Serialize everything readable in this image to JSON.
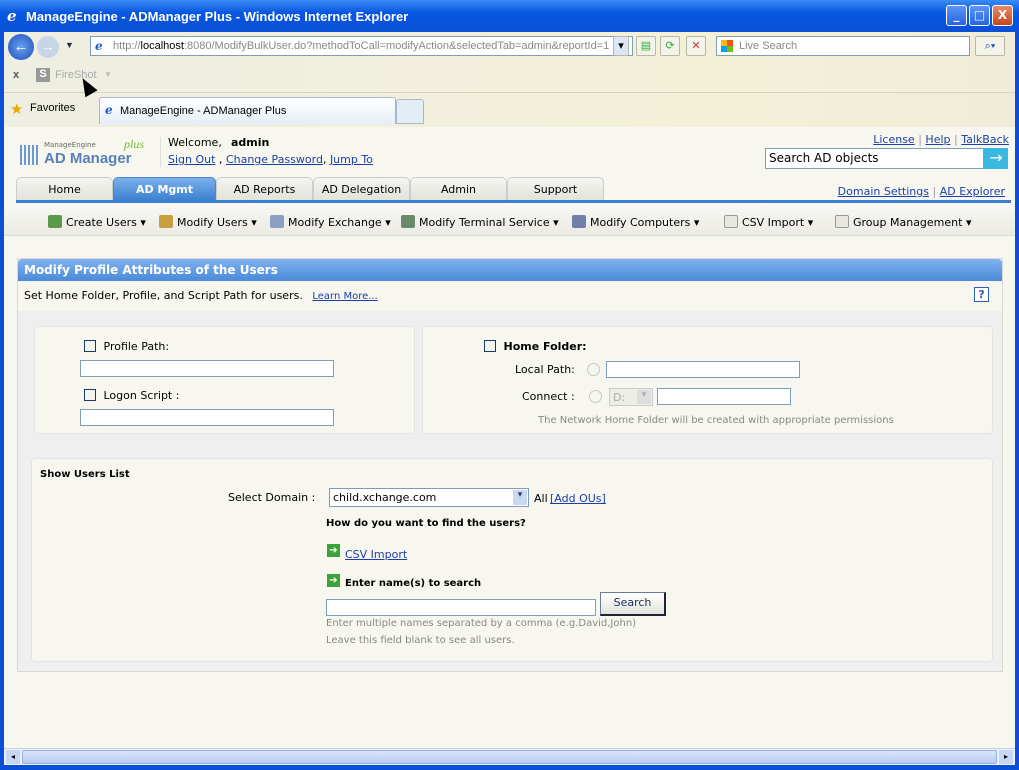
{
  "window": {
    "title": "ManageEngine - ADManager Plus - Windows Internet Explorer",
    "minimize": "_",
    "maximize": "□",
    "close": "X"
  },
  "browser": {
    "address_prefix": "http://",
    "address_host": "localhost",
    "address_rest": ":8080/ModifyBulkUser.do?methodToCall=modifyAction&selectedTab=admin&reportId=1",
    "search_placeholder": "Live Search",
    "fireshot_label": "FireShot",
    "fireshot_close": "x",
    "favorites_label": "Favorites",
    "tab_title": "ManageEngine - ADManager Plus"
  },
  "header": {
    "logo_small": "ManageEngine",
    "logo_main": "AD Manager",
    "logo_plus": "plus",
    "welcome": "Welcome,",
    "username": "admin",
    "sign_out": "Sign Out",
    "change_password": "Change Password",
    "jump_to": "Jump To",
    "top_links": [
      "License",
      "Help",
      "TalkBack"
    ],
    "search_placeholder": "Search AD objects"
  },
  "tabs": [
    {
      "label": "Home"
    },
    {
      "label": "AD Mgmt",
      "active": true
    },
    {
      "label": "AD Reports"
    },
    {
      "label": "AD Delegation"
    },
    {
      "label": "Admin"
    },
    {
      "label": "Support"
    }
  ],
  "tab_links": [
    "Domain Settings",
    "AD Explorer"
  ],
  "submenu": [
    {
      "label": "Create Users"
    },
    {
      "label": "Modify Users"
    },
    {
      "label": "Modify Exchange"
    },
    {
      "label": "Modify Terminal Service"
    },
    {
      "label": "Modify Computers"
    },
    {
      "label": "CSV Import"
    },
    {
      "label": "Group Management"
    }
  ],
  "panel": {
    "title": "Modify Profile Attributes of the Users",
    "description": "Set Home Folder, Profile, and Script Path for users.",
    "learn_more": "Learn More...",
    "help": "?",
    "profile_path_label": "Profile Path:",
    "profile_path_value": "",
    "logon_script_label": "Logon Script :",
    "logon_script_value": "",
    "home_folder_label": "Home Folder:",
    "local_path_label": "Local Path:",
    "local_path_value": "",
    "connect_label": "Connect :",
    "connect_drive": "D:",
    "connect_value": "",
    "network_note": "The Network Home Folder will be created with appropriate permissions"
  },
  "users_list": {
    "title": "Show Users List",
    "select_domain_label": "Select Domain :",
    "domain_value": "child.xchange.com",
    "all_label": "All",
    "add_ous": "[Add OUs]",
    "find_question": "How do you want to find the users?",
    "csv_import": "CSV Import",
    "enter_names_label": "Enter name(s) to search",
    "names_value": "",
    "search_button": "Search",
    "hint1": "Enter multiple names separated by a comma (e.g.David,John)",
    "hint2": "Leave this field blank to see all users."
  },
  "colors": {
    "accent": "#3a7fd0",
    "titlebar": "#0a4fd6",
    "link": "#1a3fa8"
  }
}
